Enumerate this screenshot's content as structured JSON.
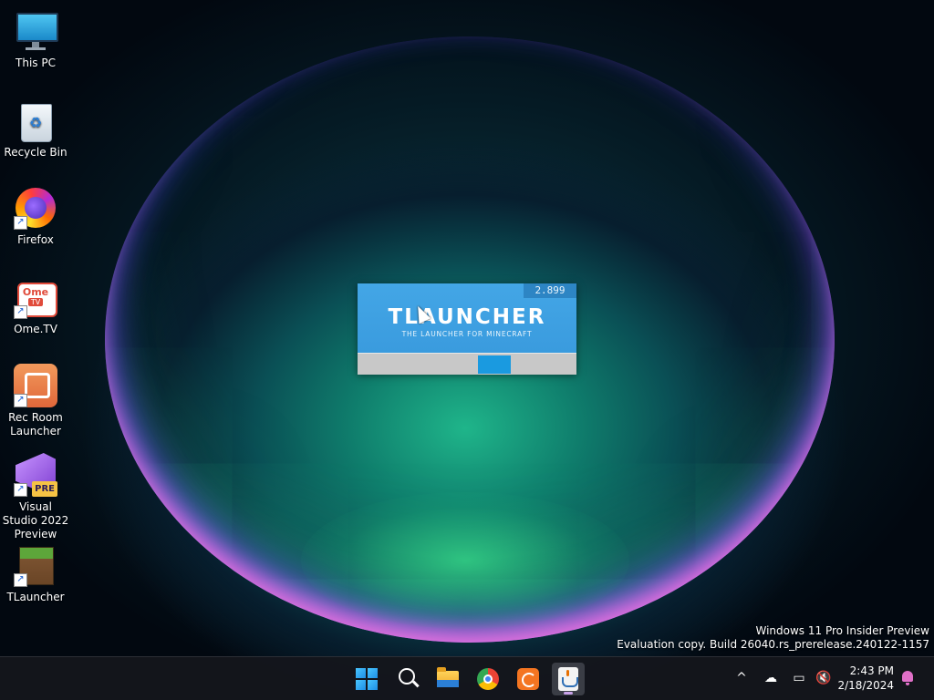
{
  "desktop": {
    "icons": [
      {
        "label": "This PC",
        "icon": "computer-icon"
      },
      {
        "label": "Recycle Bin",
        "icon": "recycle-bin-icon"
      },
      {
        "label": "Firefox",
        "icon": "firefox-icon"
      },
      {
        "label": "Ome.TV",
        "icon": "ome-tv-icon"
      },
      {
        "label": "Rec Room Launcher",
        "icon": "rec-room-icon"
      },
      {
        "label": "Visual Studio 2022 Preview",
        "icon": "visual-studio-icon"
      },
      {
        "label": "TLauncher",
        "icon": "minecraft-grass-block-icon"
      }
    ],
    "ome_logo_text": "Ome",
    "ome_logo_sub": "TV",
    "vs_badge": "PRE"
  },
  "splash": {
    "version": "2.899",
    "title": "TLAUNCHER",
    "subtitle": "THE LAUNCHER FOR MINECRAFT",
    "accent_color": "#3a9bde",
    "progress_chunk_color": "#1a9ae0"
  },
  "watermark": {
    "line1": "Windows 11 Pro Insider Preview",
    "line2": "Evaluation copy. Build 26040.rs_prerelease.240122-1157"
  },
  "taskbar": {
    "apps": [
      {
        "name": "Start",
        "icon": "windows-logo-icon"
      },
      {
        "name": "Search",
        "icon": "search-icon"
      },
      {
        "name": "File Explorer",
        "icon": "folder-icon"
      },
      {
        "name": "Google Chrome",
        "icon": "chrome-icon"
      },
      {
        "name": "Crunchyroll",
        "icon": "crunchyroll-icon"
      },
      {
        "name": "Java",
        "icon": "java-icon",
        "active": true
      }
    ],
    "tray": {
      "chevron": "^",
      "time": "2:43 PM",
      "date": "2/18/2024"
    }
  }
}
